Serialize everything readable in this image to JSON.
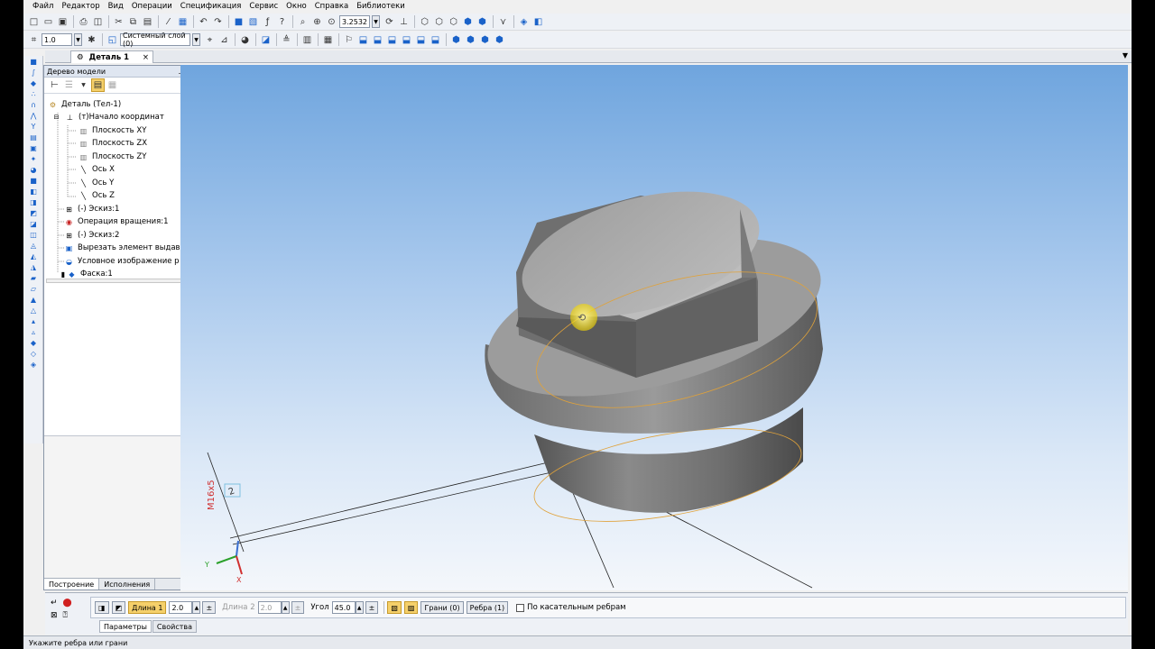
{
  "menu": [
    "Файл",
    "Редактор",
    "Вид",
    "Операции",
    "Спецификация",
    "Сервис",
    "Окно",
    "Справка",
    "Библиотеки"
  ],
  "toolbar": {
    "zoom_value": "3.2532",
    "scale_value": "1.0",
    "layer_value": "Системный слой (0)"
  },
  "doc_tab": {
    "label": "Деталь 1",
    "close": "×"
  },
  "tree": {
    "title": "Дерево модели",
    "nodes": [
      {
        "label": "Деталь (Тел-1)"
      },
      {
        "label": "(т)Начало координат"
      },
      {
        "label": "Плоскость XY"
      },
      {
        "label": "Плоскость ZX"
      },
      {
        "label": "Плоскость ZY"
      },
      {
        "label": "Ось X"
      },
      {
        "label": "Ось Y"
      },
      {
        "label": "Ось Z"
      },
      {
        "label": "(-) Эскиз:1"
      },
      {
        "label": "Операция вращения:1"
      },
      {
        "label": "(-) Эскиз:2"
      },
      {
        "label": "Вырезать элемент выдав"
      },
      {
        "label": "Условное изображение р"
      },
      {
        "label": "Фаска:1"
      }
    ],
    "tabs": [
      "Построение",
      "Исполнения"
    ]
  },
  "viewport": {
    "thread_label": "M16x5",
    "dim_label": "2",
    "axis_x": "X",
    "axis_y": "Y"
  },
  "props": {
    "length1_label": "Длина 1",
    "length1_value": "2.0",
    "length2_label": "Длина 2",
    "length2_value": "2.0",
    "angle_label": "Угол",
    "angle_value": "45.0",
    "faces_btn": "Грани (0)",
    "edges_btn": "Ребра (1)",
    "tangent_label": "По касательным ребрам",
    "tabs": [
      "Параметры",
      "Свойства"
    ]
  },
  "status": "Укажите ребра или грани"
}
